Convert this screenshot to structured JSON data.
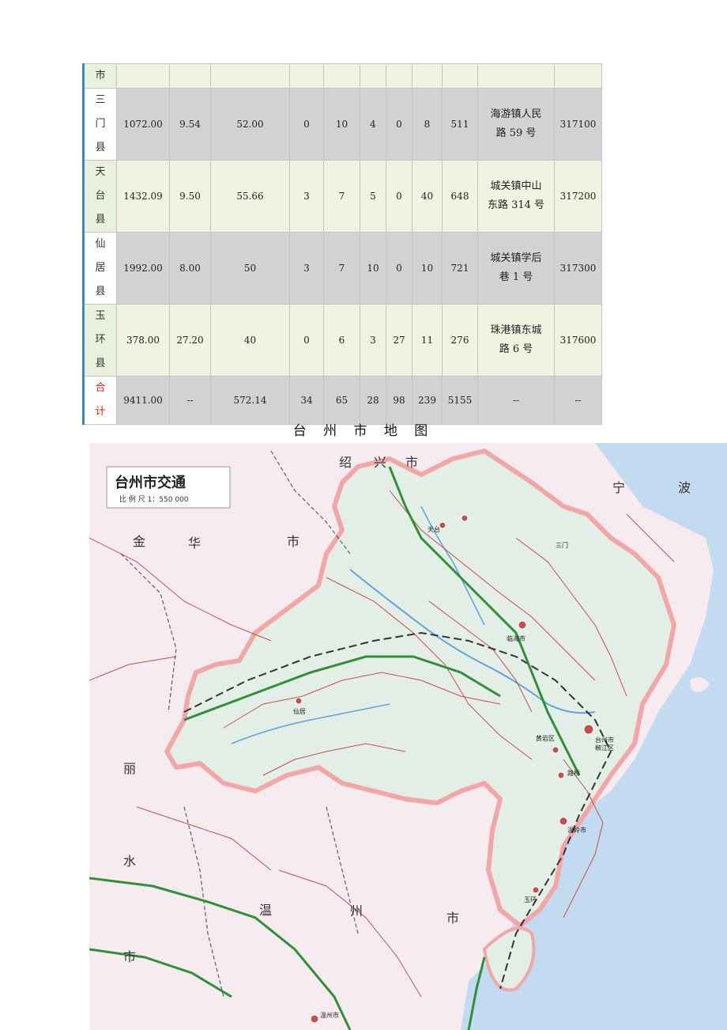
{
  "table": {
    "rows": [
      {
        "name": [
          "市"
        ],
        "cells": [
          "",
          "",
          "",
          "",
          "",
          "",
          "",
          "",
          "",
          "",
          ""
        ],
        "style": "light",
        "total": false
      },
      {
        "name": [
          "三",
          "门",
          "县"
        ],
        "cells": [
          "1072.00",
          "9.54",
          "52.00",
          "0",
          "10",
          "4",
          "0",
          "8",
          "511",
          [
            "海游镇人民",
            "路 59 号"
          ],
          "317100"
        ],
        "style": "gray",
        "total": false
      },
      {
        "name": [
          "天",
          "台",
          "县"
        ],
        "cells": [
          "1432.09",
          "9.50",
          "55.66",
          "3",
          "7",
          "5",
          "0",
          "40",
          "648",
          [
            "城关镇中山",
            "东路 314 号"
          ],
          "317200"
        ],
        "style": "light",
        "total": false
      },
      {
        "name": [
          "仙",
          "居",
          "县"
        ],
        "cells": [
          "1992.00",
          "8.00",
          "50",
          "3",
          "7",
          "10",
          "0",
          "10",
          "721",
          [
            "城关镇学后",
            "巷 1 号"
          ],
          "317300"
        ],
        "style": "gray",
        "total": false
      },
      {
        "name": [
          "玉",
          "环",
          "县"
        ],
        "cells": [
          "378.00",
          "27.20",
          "40",
          "0",
          "6",
          "3",
          "27",
          "11",
          "276",
          [
            "珠港镇东城",
            "路 6 号"
          ],
          "317600"
        ],
        "style": "light",
        "total": false
      },
      {
        "name": [
          "合",
          "计"
        ],
        "cells": [
          "9411.00",
          "--",
          "572.14",
          "34",
          "65",
          "28",
          "98",
          "239",
          "5155",
          "--",
          "--"
        ],
        "style": "gray",
        "total": true
      }
    ]
  },
  "map": {
    "page_title": "台 州 市 地 图",
    "legend_title": "台州市交通",
    "legend_scale": "比 例 尺  1：550 000",
    "region_labels": [
      {
        "text": "绍",
        "key": "shaoxing1"
      },
      {
        "text": "兴",
        "key": "shaoxing2"
      },
      {
        "text": "市",
        "key": "shaoxing3"
      },
      {
        "text": "宁",
        "key": "ningbo1"
      },
      {
        "text": "波",
        "key": "ningbo2"
      },
      {
        "text": "金",
        "key": "jinhua1"
      },
      {
        "text": "华",
        "key": "jinhua2"
      },
      {
        "text": "市",
        "key": "jinhua3"
      },
      {
        "text": "丽",
        "key": "lishui1"
      },
      {
        "text": "水",
        "key": "lishui2"
      },
      {
        "text": "市",
        "key": "lishui3"
      },
      {
        "text": "温",
        "key": "wenzhou1"
      },
      {
        "text": "州",
        "key": "wenzhou2"
      },
      {
        "text": "市",
        "key": "wenzhou3"
      }
    ],
    "place_labels": [
      {
        "text": "临海市",
        "key": "linhai"
      },
      {
        "text": "台州市",
        "key": "taizhou"
      },
      {
        "text": "椒江区",
        "key": "jiaojiang"
      },
      {
        "text": "黄岩区",
        "key": "huangyan"
      },
      {
        "text": "路桥",
        "key": "luqiao"
      },
      {
        "text": "温岭市",
        "key": "wenling"
      },
      {
        "text": "天台",
        "key": "tiantai"
      },
      {
        "text": "三门",
        "key": "sanmen"
      },
      {
        "text": "仙居",
        "key": "xianju"
      },
      {
        "text": "玉环",
        "key": "yuhuan"
      },
      {
        "text": "温州市",
        "key": "wenzhoucity"
      }
    ],
    "colors": {
      "land": "#f6ecef",
      "taizhou_land": "#e3efe6",
      "sea": "#c2dbf0",
      "border": "#f2a6a8",
      "road_green": "#2f8f3a",
      "road_red": "#c0504d",
      "river": "#5fa3d8"
    }
  }
}
